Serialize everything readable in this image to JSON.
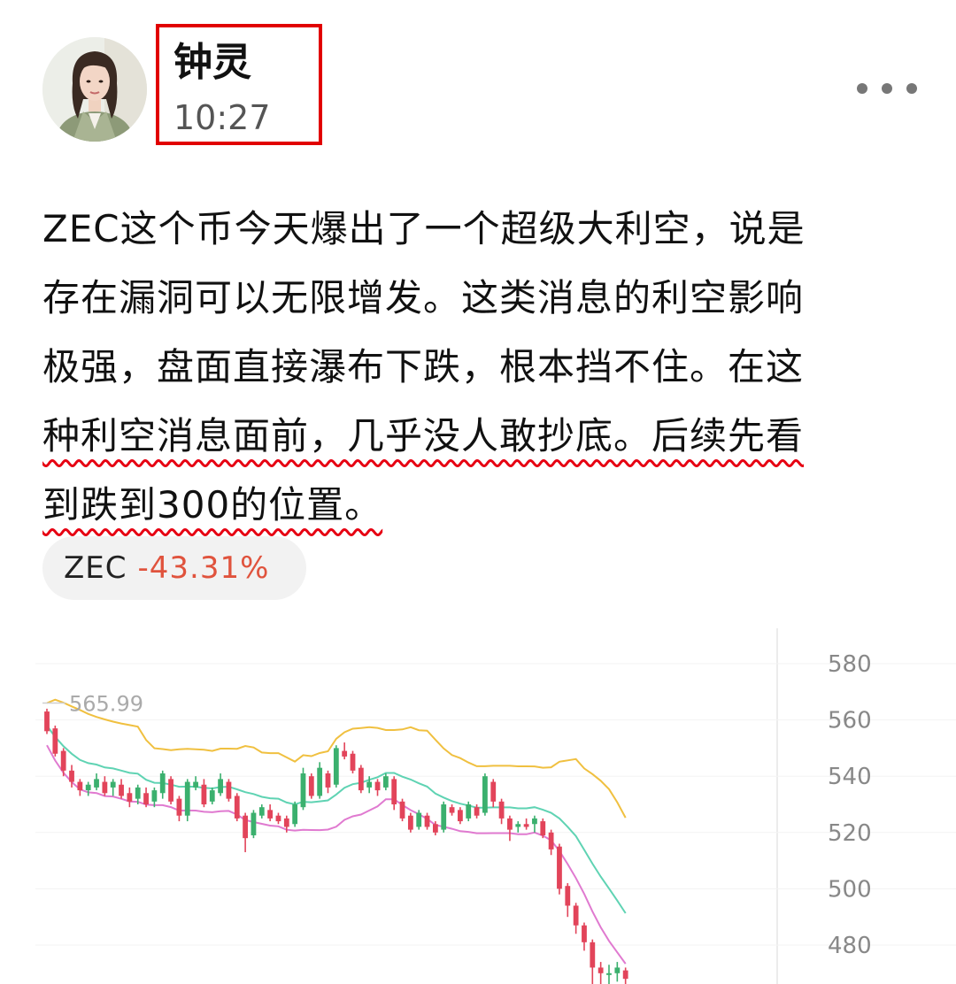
{
  "author": {
    "name": "钟灵",
    "time": "10:27"
  },
  "post": {
    "lines": [
      "ZEC这个币今天爆出了一个超级大利空，说是",
      "存在漏洞可以无限增发。这类消息的利空影响",
      "极强，盘面直接瀑布下跌，根本挡不住。在这",
      "种利空消息面前，几乎没人敢抄底。后续先看",
      "到跌到300的位置。"
    ]
  },
  "ticker": {
    "symbol": "ZEC",
    "change": "-43.31%"
  },
  "colors": {
    "up": "#3bb06e",
    "down": "#e2445a",
    "band_upper": "#f0c040",
    "band_middle": "#5fd3b3",
    "band_lower": "#e07ad0",
    "highlight_border": "#e10000",
    "underline": "#e60012"
  },
  "icons": {
    "more": "more-dots-icon"
  },
  "chart_data": {
    "type": "candlestick",
    "y_ticks": [
      "580",
      "560",
      "540",
      "520",
      "500",
      "480"
    ],
    "ylim": [
      466,
      585
    ],
    "last_price_label": "565.99",
    "series": [
      {
        "name": "",
        "values": [
          [
            563,
            556,
            564,
            555
          ],
          [
            557,
            548,
            558,
            547
          ],
          [
            549,
            542,
            550,
            540
          ],
          [
            542,
            538,
            544,
            536
          ],
          [
            538,
            535,
            539,
            533
          ],
          [
            535,
            537,
            538,
            533
          ],
          [
            536,
            539,
            541,
            535
          ],
          [
            538,
            534,
            540,
            533
          ],
          [
            536,
            538,
            539,
            533
          ],
          [
            537,
            533,
            539,
            532
          ],
          [
            534,
            531,
            536,
            529
          ],
          [
            532,
            536,
            537,
            530
          ],
          [
            534,
            530,
            536,
            529
          ],
          [
            531,
            535,
            536,
            529
          ],
          [
            534,
            541,
            542,
            532
          ],
          [
            539,
            531,
            540,
            530
          ],
          [
            532,
            526,
            533,
            524
          ],
          [
            526,
            538,
            539,
            524
          ],
          [
            536,
            538,
            540,
            535
          ],
          [
            537,
            530,
            539,
            529
          ],
          [
            531,
            535,
            536,
            530
          ],
          [
            534,
            539,
            541,
            533
          ],
          [
            538,
            532,
            539,
            531
          ],
          [
            533,
            525,
            534,
            524
          ],
          [
            526,
            518,
            527,
            513
          ],
          [
            519,
            527,
            528,
            518
          ],
          [
            526,
            529,
            530,
            525
          ],
          [
            528,
            525,
            530,
            524
          ],
          [
            526,
            524,
            527,
            523
          ],
          [
            525,
            522,
            526,
            520
          ],
          [
            523,
            530,
            531,
            522
          ],
          [
            529,
            541,
            543,
            528
          ],
          [
            540,
            533,
            541,
            532
          ],
          [
            533,
            543,
            545,
            532
          ],
          [
            541,
            536,
            542,
            534
          ],
          [
            537,
            550,
            551,
            536
          ],
          [
            549,
            547,
            552,
            546
          ],
          [
            548,
            542,
            549,
            541
          ],
          [
            543,
            535,
            544,
            534
          ],
          [
            536,
            538,
            540,
            534
          ],
          [
            538,
            535,
            539,
            533
          ],
          [
            536,
            540,
            541,
            535
          ],
          [
            539,
            530,
            540,
            528
          ],
          [
            531,
            525,
            532,
            524
          ],
          [
            526,
            521,
            527,
            520
          ],
          [
            522,
            527,
            528,
            521
          ],
          [
            526,
            522,
            527,
            521
          ],
          [
            523,
            520,
            524,
            519
          ],
          [
            521,
            530,
            531,
            520
          ],
          [
            529,
            527,
            530,
            526
          ],
          [
            528,
            524,
            529,
            523
          ],
          [
            525,
            530,
            531,
            524
          ],
          [
            529,
            526,
            530,
            525
          ],
          [
            527,
            540,
            541,
            526
          ],
          [
            538,
            531,
            539,
            529
          ],
          [
            531,
            525,
            532,
            523
          ],
          [
            525,
            521,
            526,
            517
          ],
          [
            522,
            523,
            524,
            520
          ],
          [
            523,
            522,
            525,
            521
          ],
          [
            523,
            525,
            526,
            520
          ],
          [
            524,
            519,
            525,
            518
          ],
          [
            520,
            514,
            521,
            512
          ],
          [
            515,
            500,
            516,
            498
          ],
          [
            501,
            494,
            502,
            490
          ],
          [
            494,
            487,
            495,
            484
          ],
          [
            487,
            481,
            488,
            478
          ],
          [
            481,
            472,
            482,
            466
          ],
          [
            472,
            470,
            474,
            466
          ],
          [
            470,
            470,
            473,
            466
          ],
          [
            470,
            472,
            474,
            467
          ],
          [
            471,
            468,
            472,
            466
          ]
        ]
      }
    ],
    "bands": {
      "upper": [
        null,
        null,
        null,
        null,
        null,
        null,
        null,
        null,
        null,
        null,
        null,
        null,
        null,
        null,
        null,
        null,
        null,
        null,
        null,
        null,
        null,
        null,
        null,
        null,
        null,
        null,
        null,
        null,
        null,
        null,
        null,
        null,
        null,
        null,
        null,
        null,
        null,
        null,
        null,
        null,
        null,
        null,
        null,
        null,
        null,
        null,
        null,
        null,
        null,
        null,
        null,
        null,
        null,
        null,
        null,
        null,
        null,
        null,
        null,
        null,
        null,
        null,
        null,
        null,
        null,
        null,
        null,
        null,
        null,
        null,
        null
      ],
      "middle_start": 558,
      "lower_start": 551
    }
  }
}
